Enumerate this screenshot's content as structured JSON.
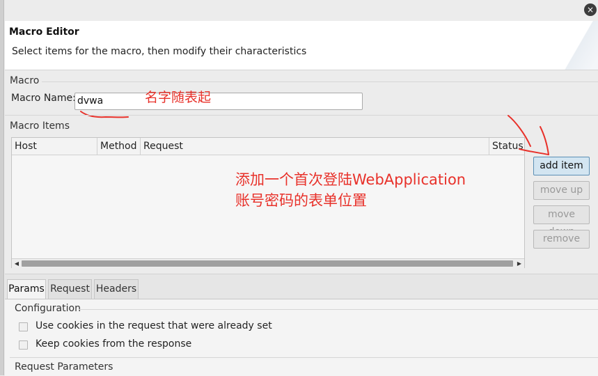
{
  "window": {
    "close_glyph": "×"
  },
  "header": {
    "title": "Macro Editor",
    "description": "Select items for the macro, then modify their characteristics"
  },
  "macro": {
    "group_label": "Macro",
    "name_label": "Macro Name:",
    "name_value": "dvwa"
  },
  "macro_items": {
    "group_label": "Macro Items",
    "columns": [
      "Host",
      "Method",
      "Request",
      "Status"
    ],
    "rows": []
  },
  "buttons": {
    "add_item": "add item",
    "move_up": "move up",
    "move_down": "move down",
    "remove": "remove"
  },
  "annotations": {
    "name_note": "名字随表起",
    "table_note_line1": "添加一个首次登陆WebApplication",
    "table_note_line2": "账号密码的表单位置",
    "color": "#e8312a"
  },
  "tabs": [
    {
      "label": "Params",
      "active": true
    },
    {
      "label": "Request",
      "active": false
    },
    {
      "label": "Headers",
      "active": false
    }
  ],
  "params": {
    "configuration_label": "Configuration",
    "options": [
      {
        "label": "Use cookies in the request that were already set",
        "checked": false
      },
      {
        "label": "Keep cookies from the response",
        "checked": false
      }
    ],
    "request_parameters_label": "Request Parameters"
  }
}
